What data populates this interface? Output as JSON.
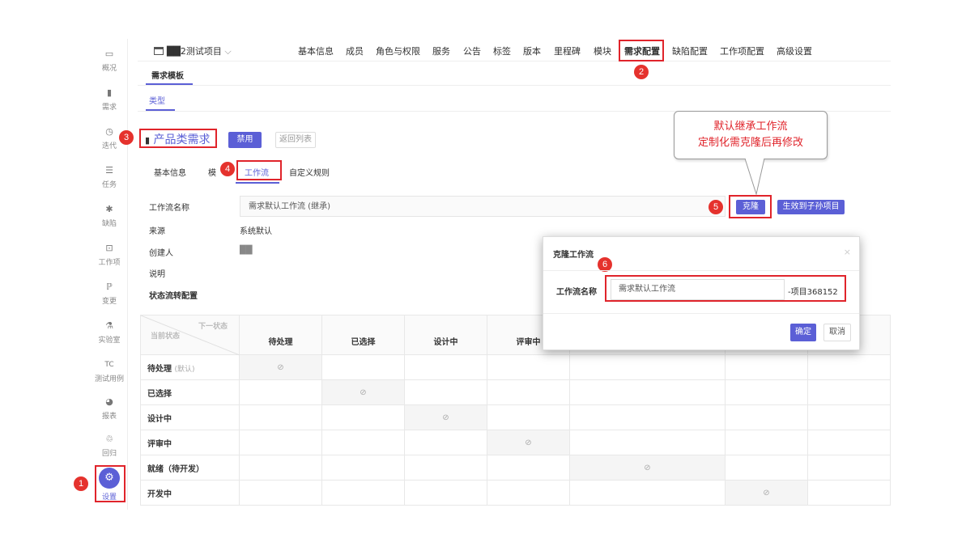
{
  "sidebar": {
    "items": [
      {
        "icon": "overview-icon",
        "glyph": "▭",
        "label": "概况"
      },
      {
        "icon": "bookmark-icon",
        "glyph": "▮",
        "label": "需求"
      },
      {
        "icon": "clock-icon",
        "glyph": "◷",
        "label": "迭代"
      },
      {
        "icon": "task-icon",
        "glyph": "☰",
        "label": "任务"
      },
      {
        "icon": "bug-icon",
        "glyph": "✱",
        "label": "缺陷"
      },
      {
        "icon": "workitem-icon",
        "glyph": "⊡",
        "label": "工作项"
      },
      {
        "icon": "change-icon",
        "glyph": "ℙ",
        "label": "变更"
      },
      {
        "icon": "lab-icon",
        "glyph": "⚗",
        "label": "实验室"
      },
      {
        "icon": "testcase-icon",
        "glyph": "TC",
        "label": "测试用例"
      },
      {
        "icon": "report-icon",
        "glyph": "◕",
        "label": "报表"
      },
      {
        "icon": "regression-icon",
        "glyph": "♲",
        "label": "回归"
      },
      {
        "icon": "gear-icon",
        "glyph": "⚙",
        "label": "设置"
      }
    ]
  },
  "topbar": {
    "project_name": "██2测试项目",
    "nav": [
      "基本信息",
      "成员",
      "角色与权限",
      "服务",
      "公告",
      "标签",
      "版本",
      "里程碑",
      "模块",
      "需求配置",
      "缺陷配置",
      "工作项配置",
      "高级设置"
    ],
    "active_nav": "需求配置"
  },
  "subtabs": {
    "template": "需求模板",
    "type": "类型"
  },
  "header": {
    "title": "产品类需求",
    "disable_btn": "禁用",
    "back_btn": "返回列表"
  },
  "detail_tabs": [
    "基本信息",
    "模",
    "工作流",
    "自定义规则"
  ],
  "workflow": {
    "name_label": "工作流名称",
    "name_value": "需求默认工作流 (继承)",
    "source_label": "来源",
    "source_value": "系统默认",
    "creator_label": "创建人",
    "creator_value": "██",
    "desc_label": "说明",
    "state_label": "状态流转配置",
    "clone_btn": "克隆",
    "apply_btn": "生效到子孙项目"
  },
  "table": {
    "corner_next": "下一状态",
    "corner_current": "当前状态",
    "columns": [
      "待处理",
      "已选择",
      "设计中",
      "评审中"
    ],
    "rows": [
      {
        "label": "待处理",
        "note": "(默认)"
      },
      {
        "label": "已选择",
        "note": ""
      },
      {
        "label": "设计中",
        "note": ""
      },
      {
        "label": "评审中",
        "note": ""
      },
      {
        "label": "就绪（待开发）",
        "note": ""
      },
      {
        "label": "开发中",
        "note": ""
      }
    ],
    "disabled_glyph": "⊘"
  },
  "callout": {
    "line1": "默认继承工作流",
    "line2": "定制化需克隆后再修改"
  },
  "dialog": {
    "title": "克隆工作流",
    "close": "×",
    "field_label": "工作流名称",
    "field_value": "需求默认工作流",
    "suffix": "-项目368152",
    "ok_btn": "确定",
    "cancel_btn": "取消"
  },
  "annotations": [
    "1",
    "2",
    "3",
    "4",
    "5",
    "6"
  ],
  "colors": {
    "accent": "#5b5fd6",
    "annotation_red": "#e0242b"
  }
}
